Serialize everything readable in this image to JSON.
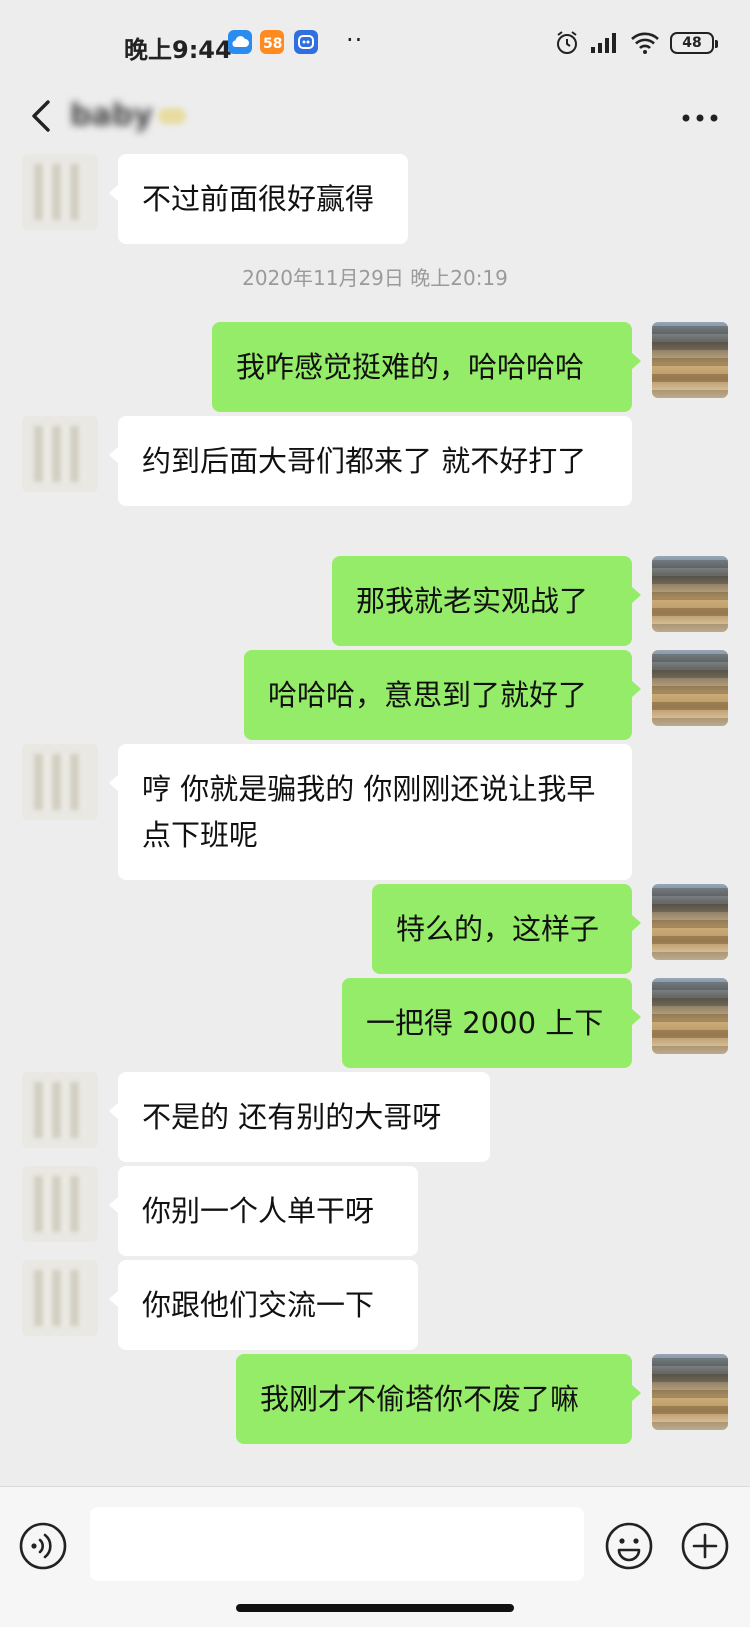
{
  "status_bar": {
    "time": "晚上9:44",
    "app_badges": [
      "cloud-icon",
      "orange-app-icon",
      "blue-app-icon"
    ],
    "extra": "··",
    "icons": [
      "alarm-icon",
      "signal-icon",
      "wifi-icon"
    ],
    "battery": "48"
  },
  "header": {
    "contact_name": "baby"
  },
  "chat": {
    "messages": [
      {
        "side": "other",
        "text": "不过前面很好赢得"
      },
      {
        "type": "timestamp",
        "text": "2020年11月29日 晚上20:19"
      },
      {
        "side": "self",
        "text": "我咋感觉挺难的，哈哈哈哈"
      },
      {
        "side": "other",
        "text": "约到后面大哥们都来了 就不好打了"
      },
      {
        "side": "self",
        "text": "那我就老实观战了"
      },
      {
        "side": "self",
        "text": "哈哈哈，意思到了就好了"
      },
      {
        "side": "other",
        "text": "哼 你就是骗我的 你刚刚还说让我早点下班呢"
      },
      {
        "side": "self",
        "text": "特么的，这样子"
      },
      {
        "side": "self",
        "text": "一把得 2000 上下"
      },
      {
        "side": "other",
        "text": "不是的 还有别的大哥呀"
      },
      {
        "side": "other",
        "text": "你别一个人单干呀"
      },
      {
        "side": "other",
        "text": "你跟他们交流一下"
      },
      {
        "side": "self",
        "text": "我刚才不偷塔你不废了嘛"
      }
    ]
  },
  "input_bar": {
    "placeholder": "",
    "left_icon": "voice-icon",
    "right_icons": [
      "emoji-icon",
      "plus-icon"
    ]
  },
  "colors": {
    "background": "#ededed",
    "self_bubble": "#95ec69",
    "other_bubble": "#ffffff"
  }
}
